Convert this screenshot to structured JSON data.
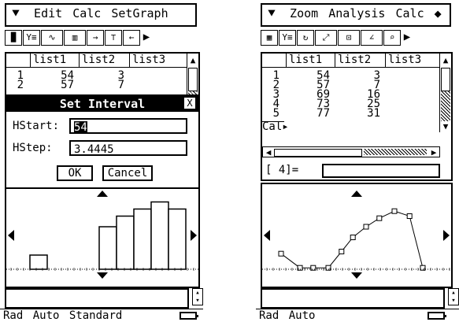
{
  "screen_a": {
    "menu": [
      "Edit",
      "Calc",
      "SetGraph"
    ],
    "table": {
      "headers": [
        "list1",
        "list2",
        "list3"
      ],
      "rows": [
        {
          "n": "1",
          "list1": "54",
          "list2": "3"
        },
        {
          "n": "2",
          "list1": "57",
          "list2": "7"
        }
      ]
    },
    "dialog": {
      "title": "Set Interval",
      "close": "X",
      "hstart_label": "HStart:",
      "hstart_value": "54",
      "hstep_label": "HStep:",
      "hstep_value": "3.4445",
      "ok": "OK",
      "cancel": "Cancel"
    },
    "status": [
      "Rad",
      "Auto",
      "Standard"
    ],
    "histogram_heights": [
      0.2,
      0,
      0,
      0,
      0.6,
      0.75,
      0.85,
      0.95,
      0.85
    ]
  },
  "screen_b": {
    "menu": [
      "Zoom",
      "Analysis",
      "Calc"
    ],
    "table": {
      "headers": [
        "list1",
        "list2",
        "list3"
      ],
      "rows": [
        {
          "n": "1",
          "list1": "54",
          "list2": "3"
        },
        {
          "n": "2",
          "list1": "57",
          "list2": "7"
        },
        {
          "n": "3",
          "list1": "69",
          "list2": "16"
        },
        {
          "n": "4",
          "list1": "73",
          "list2": "25"
        },
        {
          "n": "5",
          "list1": "77",
          "list2": "31"
        }
      ],
      "cal_label": "Cal▸"
    },
    "calc_row": "[    4]=",
    "status": [
      "Rad",
      "Auto"
    ],
    "line_points": [
      [
        0.1,
        0.22
      ],
      [
        0.2,
        0.02
      ],
      [
        0.27,
        0.02
      ],
      [
        0.35,
        0.02
      ],
      [
        0.42,
        0.25
      ],
      [
        0.48,
        0.45
      ],
      [
        0.55,
        0.6
      ],
      [
        0.62,
        0.72
      ],
      [
        0.7,
        0.82
      ],
      [
        0.78,
        0.75
      ],
      [
        0.85,
        0.02
      ]
    ]
  }
}
